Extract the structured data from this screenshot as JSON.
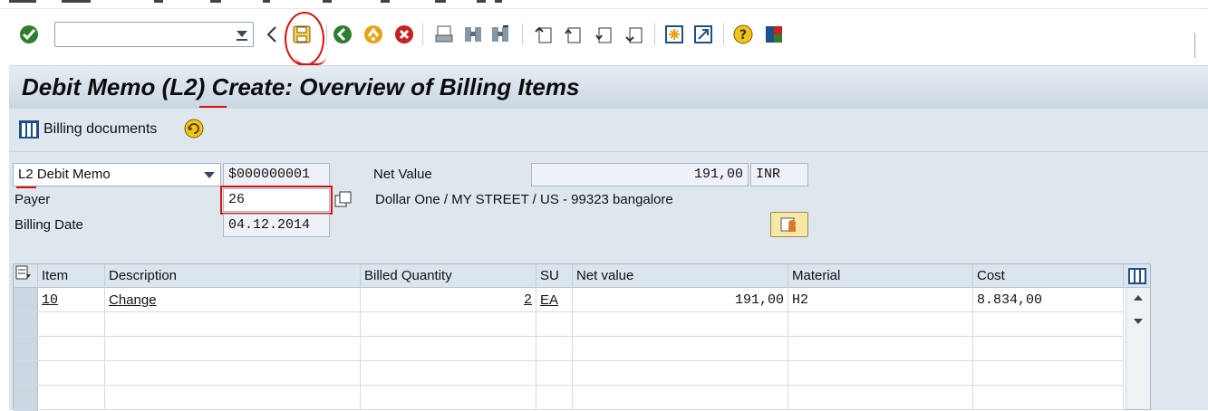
{
  "toolbar": {
    "command_field_value": "",
    "icons": [
      "enter-icon",
      "back-nav-icon",
      "save-icon",
      "back-icon",
      "exit-icon",
      "cancel-icon",
      "print-icon",
      "find-icon",
      "find-next-icon",
      "first-page-icon",
      "previous-page-icon",
      "next-page-icon",
      "last-page-icon",
      "create-session-icon",
      "shortcut-icon",
      "help-icon",
      "customize-layout-icon"
    ]
  },
  "title": "Debit Memo  (L2) Create: Overview of Billing Items",
  "app_toolbar": {
    "billing_documents_label": "Billing documents"
  },
  "header": {
    "billing_type": "L2 Debit Memo",
    "document_number": "$000000001",
    "net_value_label": "Net Value",
    "net_value": "191,00",
    "currency": "INR",
    "payer_label": "Payer",
    "payer_value": "26",
    "payer_address": "Dollar One / MY STREET / US - 99323 bangalore",
    "billing_date_label": "Billing Date",
    "billing_date": "04.12.2014"
  },
  "table": {
    "columns": [
      "Item",
      "Description",
      "Billed Quantity",
      "SU",
      "Net value",
      "Material",
      "Cost"
    ],
    "rows": [
      {
        "item": "10",
        "description": "Change",
        "billed_quantity": "2",
        "su": "EA",
        "net_value": "191,00",
        "material": "H2",
        "cost": "8.834,00"
      }
    ]
  }
}
